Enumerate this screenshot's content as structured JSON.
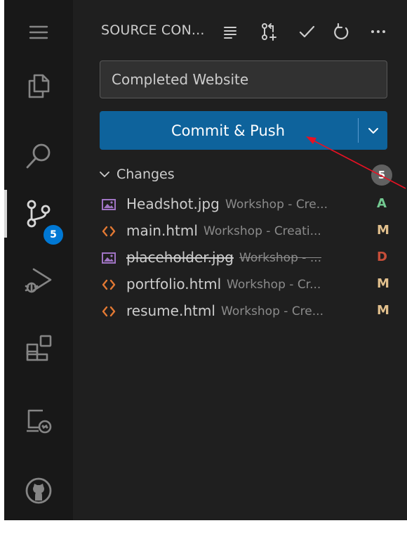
{
  "header": {
    "title": "SOURCE CON...",
    "actions": [
      "view-as-tree-icon",
      "pull-request-icon",
      "checkmark-icon",
      "refresh-icon",
      "more-actions-icon"
    ]
  },
  "activity_bar": {
    "items": [
      "menu-icon",
      "explorer-icon",
      "search-icon",
      "source-control-icon",
      "run-debug-icon",
      "extensions-icon",
      "remote-explorer-icon",
      "github-icon"
    ],
    "active": "source-control-icon",
    "scm_badge": "5"
  },
  "commit": {
    "message": "Completed Website",
    "button_label": "Commit & Push"
  },
  "changes": {
    "label": "Changes",
    "count": "5",
    "files": [
      {
        "name": "Headshot.jpg",
        "desc": "Workshop - Cre...",
        "status": "A",
        "kind": "image",
        "status_color": "#73c991"
      },
      {
        "name": "main.html",
        "desc": "Workshop - Creati...",
        "status": "M",
        "kind": "html",
        "status_color": "#e2c08d"
      },
      {
        "name": "placeholder.jpg",
        "desc": "Workshop - ...",
        "status": "D",
        "kind": "image",
        "status_color": "#c74e39"
      },
      {
        "name": "portfolio.html",
        "desc": "Workshop - Cr...",
        "status": "M",
        "kind": "html",
        "status_color": "#e2c08d"
      },
      {
        "name": "resume.html",
        "desc": "Workshop - Cre...",
        "status": "M",
        "kind": "html",
        "status_color": "#e2c08d"
      }
    ]
  },
  "colors": {
    "accent": "#0078d4",
    "button": "#0e639c",
    "annotation_arrow": "#e81123"
  }
}
